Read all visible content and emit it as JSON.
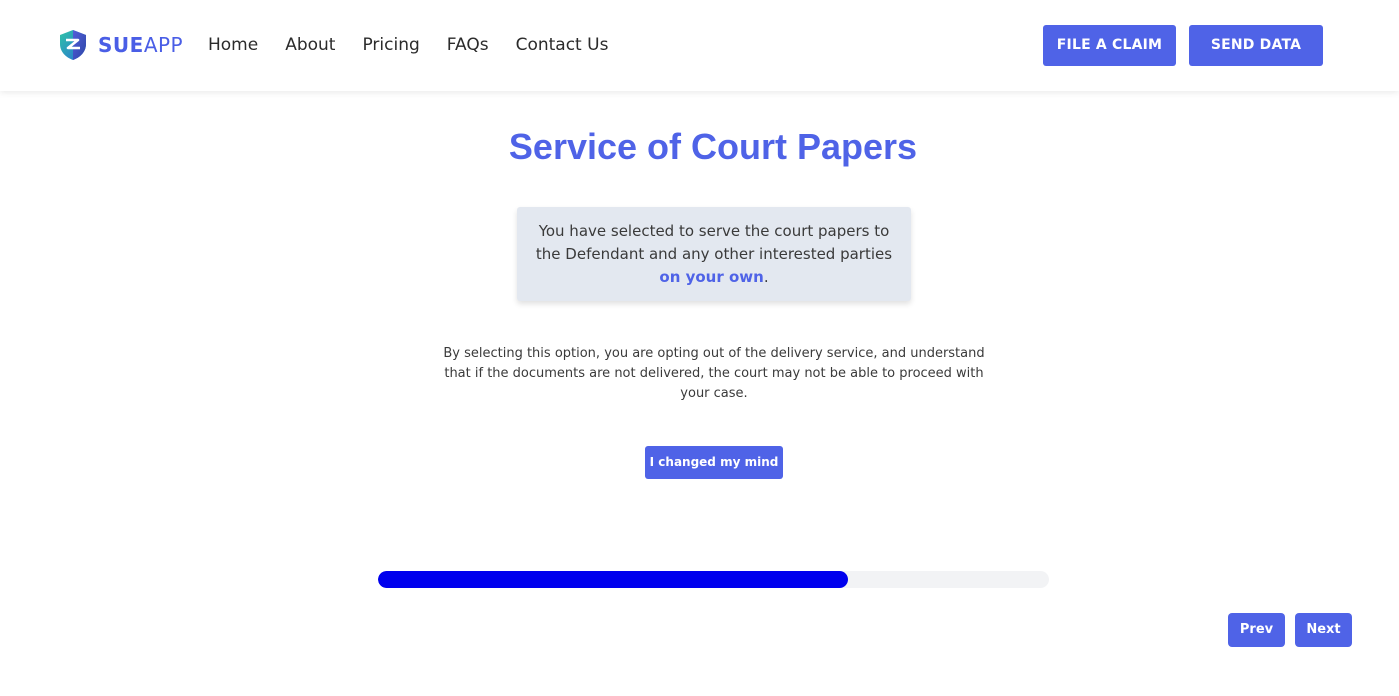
{
  "brand": {
    "name_bold": "SUE",
    "name_light": "APP",
    "color": "#4f63e7",
    "logo_icon": "shield-icon"
  },
  "nav": {
    "items": [
      {
        "label": "Home"
      },
      {
        "label": "About"
      },
      {
        "label": "Pricing"
      },
      {
        "label": "FAQs"
      },
      {
        "label": "Contact Us"
      }
    ]
  },
  "header_actions": {
    "file_claim_label": "FILE A CLAIM",
    "send_data_label": "SEND DATA"
  },
  "main": {
    "title": "Service of Court Papers",
    "info_text": "You have selected to serve the court papers to the Defendant and any other interested parties ",
    "info_highlight": "on your own",
    "info_suffix": ".",
    "description": "By selecting this option, you are opting out of the delivery service, and understand that if the documents are not delivered, the court may not be able to proceed with your case.",
    "changed_mind_label": "I changed my mind"
  },
  "progress": {
    "percent": 70,
    "fill_color": "#0000ee",
    "track_color": "#f2f3f5"
  },
  "pager": {
    "prev_label": "Prev",
    "next_label": "Next"
  }
}
